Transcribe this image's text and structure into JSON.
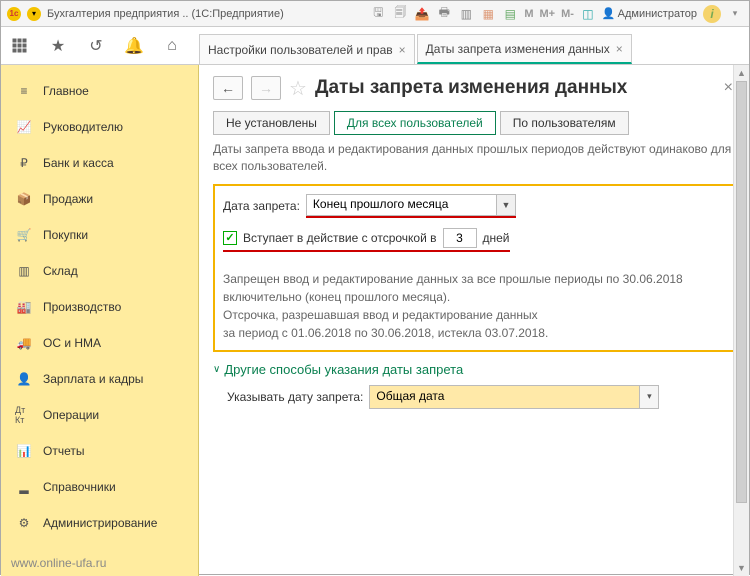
{
  "titlebar": {
    "app_title": "Бухгалтерия предприятия .. (1С:Предприятие)",
    "user_label": "Администратор"
  },
  "tabs": {
    "t1": "Настройки пользователей и прав",
    "t2": "Даты запрета изменения данных"
  },
  "sidebar": {
    "items": [
      "Главное",
      "Руководителю",
      "Банк и касса",
      "Продажи",
      "Покупки",
      "Склад",
      "Производство",
      "ОС и НМА",
      "Зарплата и кадры",
      "Операции",
      "Отчеты",
      "Справочники",
      "Администрирование"
    ],
    "footer": "www.online-ufa.ru"
  },
  "content": {
    "title": "Даты запрета изменения данных",
    "seg": {
      "a": "Не установлены",
      "b": "Для всех пользователей",
      "c": "По пользователям"
    },
    "description": "Даты запрета ввода и редактирования данных прошлых периодов действуют одинаково для всех пользователей.",
    "lock_date_label": "Дата запрета:",
    "lock_date_value": "Конец прошлого месяца",
    "delay_label_pre": "Вступает в действие с отсрочкой в",
    "delay_value": "3",
    "delay_label_post": "дней",
    "explain": "Запрещен ввод и редактирование данных за все прошлые периоды по 30.06.2018 включительно (конец прошлого месяца).\nОтсрочка, разрешавшая ввод и редактирование данных\nза период с 01.06.2018 по 30.06.2018, истекла 03.07.2018.",
    "expander": "Другие способы указания даты запрета",
    "mode_label": "Указывать дату запрета:",
    "mode_value": "Общая дата"
  }
}
